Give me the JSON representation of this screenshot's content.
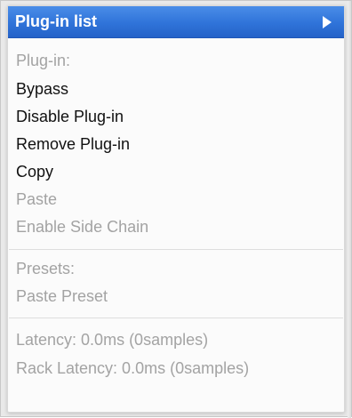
{
  "menu": {
    "header": {
      "label": "Plug-in list",
      "icon": "submenu-arrow-icon"
    },
    "groups": [
      {
        "items": [
          {
            "label": "Plug-in:",
            "enabled": false
          },
          {
            "label": "Bypass",
            "enabled": true
          },
          {
            "label": "Disable Plug-in",
            "enabled": true
          },
          {
            "label": "Remove Plug-in",
            "enabled": true
          },
          {
            "label": "Copy",
            "enabled": true
          },
          {
            "label": "Paste",
            "enabled": false
          },
          {
            "label": "Enable Side Chain",
            "enabled": false
          }
        ]
      },
      {
        "items": [
          {
            "label": "Presets:",
            "enabled": false
          },
          {
            "label": "Paste Preset",
            "enabled": false
          }
        ]
      },
      {
        "items": [
          {
            "label": "Latency: 0.0ms (0samples)",
            "enabled": false
          },
          {
            "label": "Rack Latency: 0.0ms (0samples)",
            "enabled": false
          }
        ]
      }
    ],
    "colors": {
      "highlight": "#2f73d9",
      "enabled_text": "#111111",
      "disabled_text": "#a3a3a3"
    }
  }
}
